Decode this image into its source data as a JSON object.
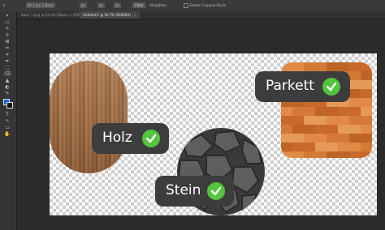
{
  "options_bar": {
    "field_1": "W: 1 px: 1 Boux",
    "field_2": "px",
    "field_3": "px",
    "field_4": "px",
    "clear_label": "Clear",
    "straighten_label": "Straighten",
    "delete_cropped_label": "Delete Cropped Pixels"
  },
  "tabs": [
    {
      "label": "Basic 1.png @ 33.3% (Ebene 1, RGB/8#)",
      "close": "×"
    },
    {
      "label": "Untitled-1 @ 16.7% (RGB/8#)",
      "close": "×"
    }
  ],
  "tools": [
    "⌖",
    "▭",
    "✎",
    "⌾",
    "⊞",
    "✂",
    "⌗",
    "✒",
    "⬚",
    "⌫",
    "▲",
    "◐",
    "✎",
    "T",
    "↖",
    "▭",
    "✋",
    "🔍"
  ],
  "swatches": {
    "foreground": "#1763d8",
    "background": "#111111"
  },
  "canvas_labels": {
    "holz": "Holz",
    "parkett": "Parkett",
    "stein": "Stein"
  },
  "colors": {
    "pill": "#3d3d3d",
    "check": "#53c43e"
  }
}
